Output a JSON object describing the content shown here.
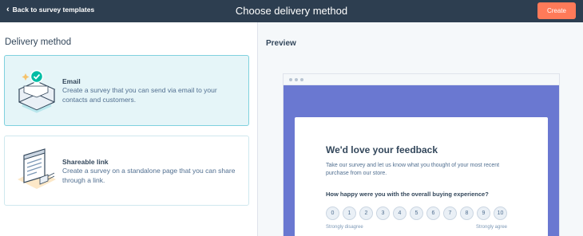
{
  "header": {
    "back_label": "Back to survey templates",
    "title": "Choose delivery method",
    "create_label": "Create"
  },
  "left": {
    "heading": "Delivery method",
    "options": [
      {
        "title": "Email",
        "description": "Create a survey that you can send via email to your contacts and customers.",
        "icon": "email-envelope-icon",
        "selected": true
      },
      {
        "title": "Shareable link",
        "description": "Create a survey on a standalone page that you can share through a link.",
        "icon": "shareable-link-page-icon",
        "selected": false
      }
    ]
  },
  "preview": {
    "label": "Preview",
    "survey": {
      "heading": "We'd love your feedback",
      "intro": "Take our survey and let us know what you thought of your most recent purchase from our store.",
      "question": "How happy were you with the overall buying experience?",
      "scale": [
        "0",
        "1",
        "2",
        "3",
        "4",
        "5",
        "6",
        "7",
        "8",
        "9",
        "10"
      ],
      "low_label": "Strongly disagree",
      "high_label": "Strongly agree"
    }
  },
  "colors": {
    "header_bg": "#2d3e50",
    "accent": "#ff7a59",
    "selected_border": "#7fd1de",
    "selected_bg": "#e5f5f8",
    "banner": "#6a78d1",
    "check": "#00bda5"
  }
}
